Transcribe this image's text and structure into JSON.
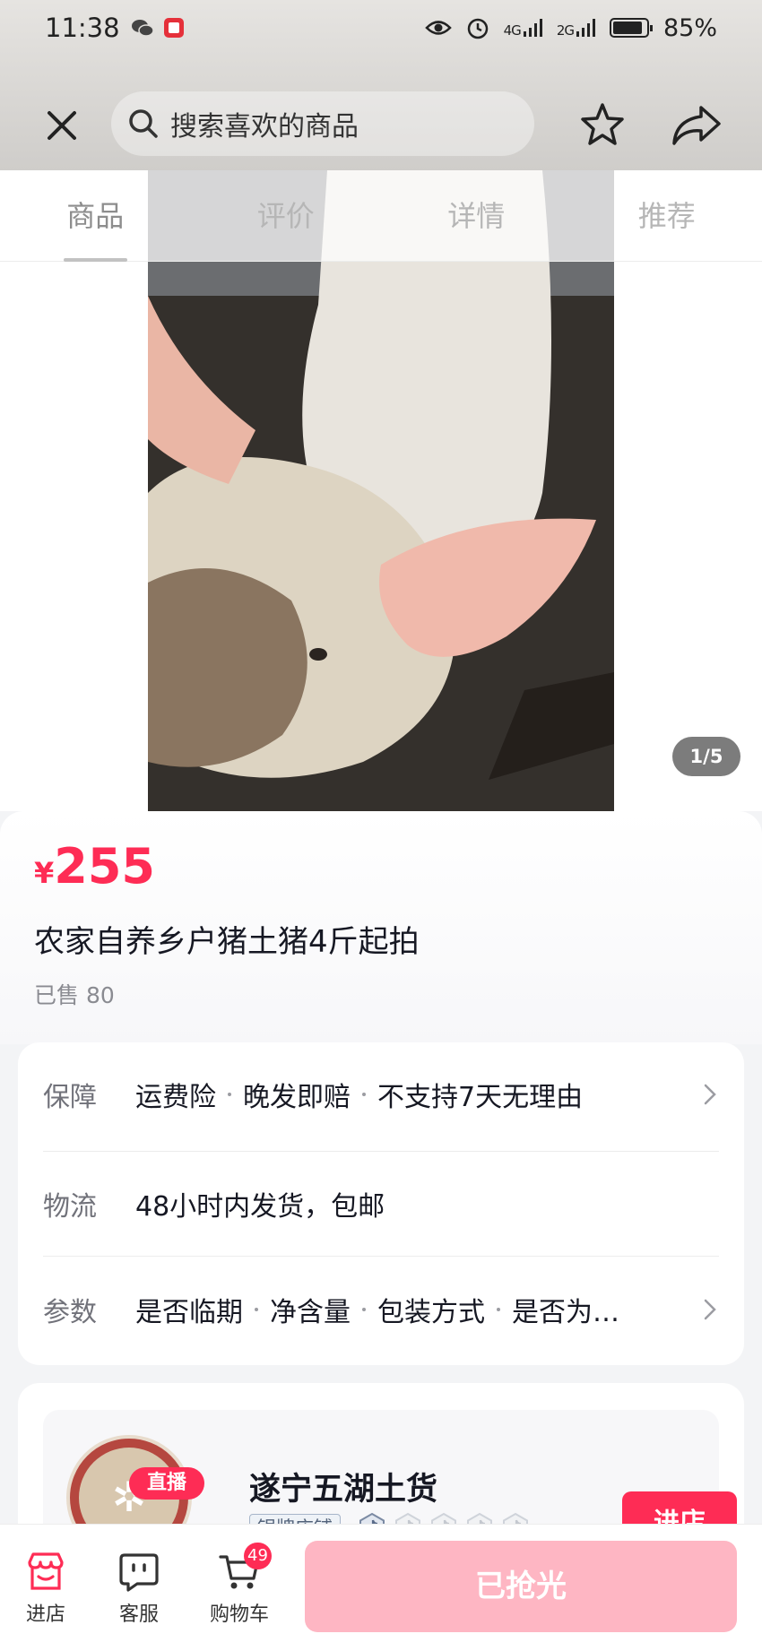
{
  "status_bar": {
    "time": "11:38",
    "signal_4g": "4G",
    "signal_2g": "2G",
    "battery": "85%"
  },
  "header": {
    "search_placeholder": "搜索喜欢的商品"
  },
  "tabs": [
    {
      "label": "商品",
      "active": true
    },
    {
      "label": "评价",
      "active": false
    },
    {
      "label": "详情",
      "active": false
    },
    {
      "label": "推荐",
      "active": false
    }
  ],
  "gallery": {
    "counter": "1/5"
  },
  "product": {
    "currency": "¥",
    "price": "255",
    "title": "农家自养乡户猪土猪4斤起拍",
    "sold": "已售 80"
  },
  "services": {
    "guarantee": {
      "label": "保障",
      "items": [
        "运费险",
        "晚发即赔",
        "不支持7天无理由"
      ]
    },
    "logistics": {
      "label": "物流",
      "value": "48小时内发货，包邮"
    },
    "params": {
      "label": "参数",
      "items": [
        "是否临期",
        "净含量",
        "包装方式",
        "是否为…"
      ]
    }
  },
  "shop": {
    "live_tag": "直播",
    "name": "遂宁五湖土货",
    "badge": "银牌店铺",
    "enter_label": "进店"
  },
  "bottom_bar": {
    "store_label": "进店",
    "service_label": "客服",
    "cart_label": "购物车",
    "cart_count": "49",
    "action_label": "已抢光"
  },
  "colors": {
    "accent": "#fe2c55",
    "soldout": "#feb6c3"
  }
}
